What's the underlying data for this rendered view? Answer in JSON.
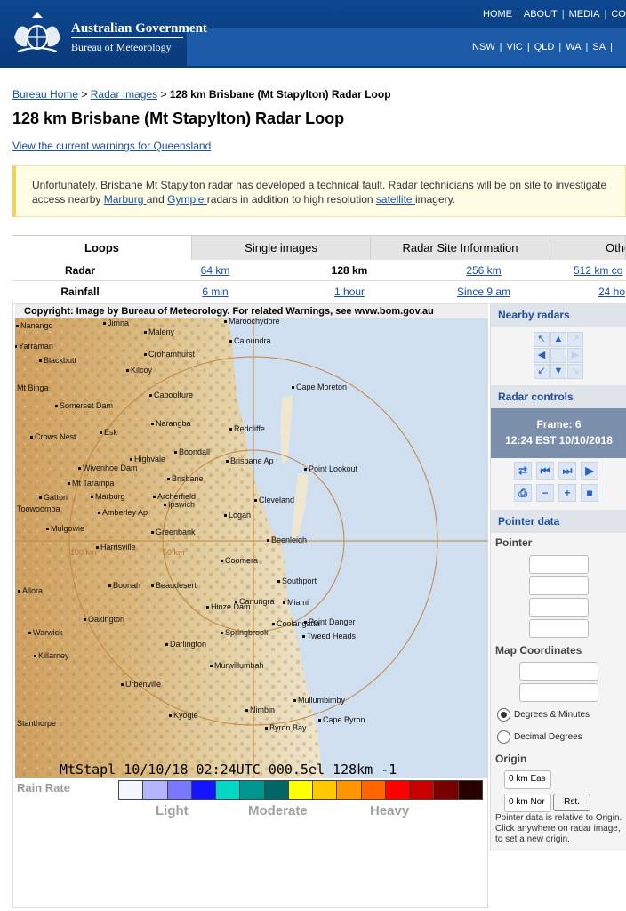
{
  "header": {
    "gov_title": "Australian Government",
    "agency": "Bureau of Meteorology",
    "top_nav": [
      "HOME",
      "ABOUT",
      "MEDIA",
      "CO"
    ],
    "state_nav": [
      "NSW",
      "VIC",
      "QLD",
      "WA",
      "SA"
    ]
  },
  "breadcrumb": {
    "home": "Bureau Home",
    "sep1": ">",
    "radar": "Radar Images",
    "sep2": ">",
    "current": "128 km Brisbane (Mt Stapylton) Radar Loop"
  },
  "page_title": "128 km Brisbane (Mt Stapylton) Radar Loop",
  "warnings_link": "View the current warnings for Queensland",
  "notice": {
    "line1": "Unfortunately, Brisbane Mt Stapylton radar has developed a technical fault. Radar technicians will be on site to investigate",
    "line2_pre": "access nearby ",
    "marburg": "Marburg ",
    "and": "and ",
    "gympie": "Gympie ",
    "radars_mid": "radars in addition to high resolution ",
    "satellite": "satellite ",
    "imagery": "imagery."
  },
  "tabs": [
    "Loops",
    "Single images",
    "Radar Site Information",
    "Othe"
  ],
  "rows": {
    "radar": {
      "label": "Radar",
      "items": [
        "64 km",
        "128 km",
        "256 km",
        "512 km co"
      ]
    },
    "rainfall": {
      "label": "Rainfall",
      "items": [
        "6 min",
        "1 hour",
        "Since 9 am",
        "24 ho"
      ]
    }
  },
  "radar": {
    "copyright": "Copyright: Image by Bureau of Meteorology. For related Warnings, see www.bom.gov.au",
    "stamp": "MtStapl 10/10/18 02:24UTC 000.5el 128km -1",
    "ring_100": "100 km",
    "ring_50": "50 km",
    "places": [
      "Nanango",
      "Jimna",
      "Maroochydore",
      "Maleny",
      "Caloundra",
      "Yarraman",
      "Blackbutt",
      "Crohamhurst",
      "Kilcoy",
      "Mt Binga",
      "Caboolture",
      "Cape Moreton",
      "Somerset Dam",
      "Narangba",
      "Redcliffe",
      "Crows Nest",
      "Esk",
      "Boondall",
      "Highvale",
      "Brisbane Ap",
      "Point Lookout",
      "Wivenhoe Dam",
      "Mt Tarampa",
      "Brisbane",
      "Gatton",
      "Marburg",
      "Archerfield",
      "Cleveland",
      "Toowoomba",
      "Amberley Ap",
      "Ipswich",
      "Logan",
      "Mulgowie",
      "Greenbank",
      "Beenleigh",
      "Harrisville",
      "Coomera",
      "Southport",
      "Allora",
      "Boonah",
      "Beaudesert",
      "Canungra",
      "Hinze Dam",
      "Miami",
      "Oakington",
      "Point Danger",
      "Coolangatta",
      "Warwick",
      "Springbrook",
      "Tweed Heads",
      "Darlington",
      "Killarney",
      "Murwillumbah",
      "Urbenville",
      "Mullumbimby",
      "Nimbin",
      "Kyogle",
      "Cape Byron",
      "Stanthorpe",
      "Byron Bay"
    ],
    "rain_rate_label": "Rain Rate",
    "scale_colors": [
      "#f5f5ff",
      "#b4b4ff",
      "#7878ff",
      "#1414ff",
      "#00d8c3",
      "#009690",
      "#006666",
      "#ffff00",
      "#ffc800",
      "#ff9600",
      "#ff6400",
      "#ff0000",
      "#c80000",
      "#780000",
      "#280000"
    ],
    "scale_labels": [
      "Light",
      "Moderate",
      "Heavy"
    ]
  },
  "panel": {
    "nearby": "Nearby radars",
    "controls": "Radar controls",
    "frame_label": "Frame: 6",
    "frame_time": "12:24 EST 10/10/2018",
    "pointer_data": "Pointer data",
    "pointer": "Pointer",
    "map_coords": "Map Coordinates",
    "deg_min": "Degrees & Minutes",
    "dec_deg": "Decimal Degrees",
    "origin": "Origin",
    "east_val": "0 km Eas",
    "north_val": "0 km Nor",
    "reset": "Rst.",
    "note": "Pointer data is relative to Origin. Click anywhere on radar image, to set a new origin."
  }
}
